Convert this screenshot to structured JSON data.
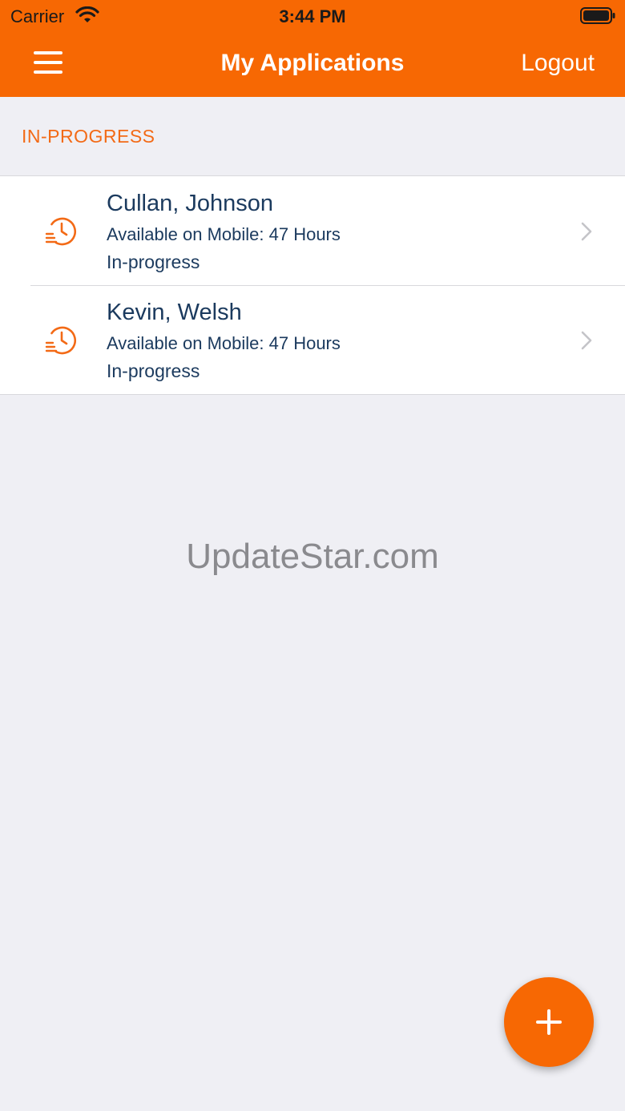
{
  "status_bar": {
    "carrier": "Carrier",
    "time": "3:44 PM"
  },
  "nav": {
    "title": "My Applications",
    "logout_label": "Logout"
  },
  "section": {
    "header": "IN-PROGRESS"
  },
  "applications": [
    {
      "name": "Cullan, Johnson",
      "availability": "Available on Mobile: 47 Hours",
      "status": "In-progress"
    },
    {
      "name": "Kevin, Welsh",
      "availability": "Available on Mobile: 47 Hours",
      "status": "In-progress"
    }
  ],
  "watermark": "UpdateStar.com",
  "colors": {
    "brand": "#f76803",
    "text_primary": "#1b3a5e",
    "background": "#efeff4"
  },
  "icons": {
    "menu": "hamburger-menu-icon",
    "row": "clock-history-icon",
    "chevron": "chevron-right-icon",
    "fab": "plus-icon"
  }
}
